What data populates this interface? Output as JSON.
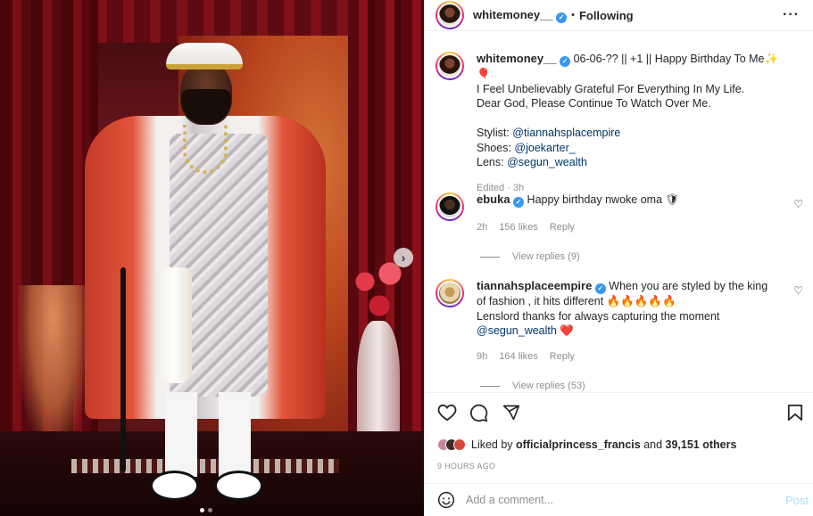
{
  "header": {
    "username": "whitemoney__",
    "follow_status": "Following",
    "more_icon": "ellipsis-icon"
  },
  "caption": {
    "username": "whitemoney__",
    "line1": "06-06-?? || +1 || Happy Birthday To Me✨🎈",
    "line2": "I Feel Unbelievably Grateful For Everything In My Life.",
    "line3": "Dear God, Please Continue To Watch Over Me.",
    "stylist_label": "Stylist:",
    "stylist_handle": "@tiannahsplacempire",
    "shoes_label": "Shoes:",
    "shoes_handle": "@joekarter_",
    "lens_label": "Lens:",
    "lens_handle": "@segun_wealth",
    "edited": "Edited · 3h"
  },
  "comments": [
    {
      "username": "ebuka",
      "text": "Happy birthday nwoke oma 🛡",
      "time": "2h",
      "likes": "156 likes",
      "reply": "Reply",
      "view_replies": "View replies (9)"
    },
    {
      "username": "tiannahsplaceempire",
      "text1": "When you are styled by the king of fashion , it hits different 🔥🔥🔥🔥🔥",
      "text2": "Lenslord thanks for always capturing the moment",
      "mention": "@segun_wealth",
      "emoji": "❤️",
      "time": "9h",
      "likes": "164 likes",
      "reply": "Reply",
      "view_replies": "View replies (53)"
    }
  ],
  "likes": {
    "prefix": "Liked by",
    "user": "officialprincess_francis",
    "middle": "and",
    "others": "39,151 others"
  },
  "timestamp": "9 HOURS AGO",
  "add_comment": {
    "placeholder": "Add a comment...",
    "post_label": "Post"
  },
  "colors": {
    "link": "#00376b",
    "verified": "#3897f0",
    "muted": "#8e8e8e",
    "post_disabled": "#b2dffc"
  }
}
